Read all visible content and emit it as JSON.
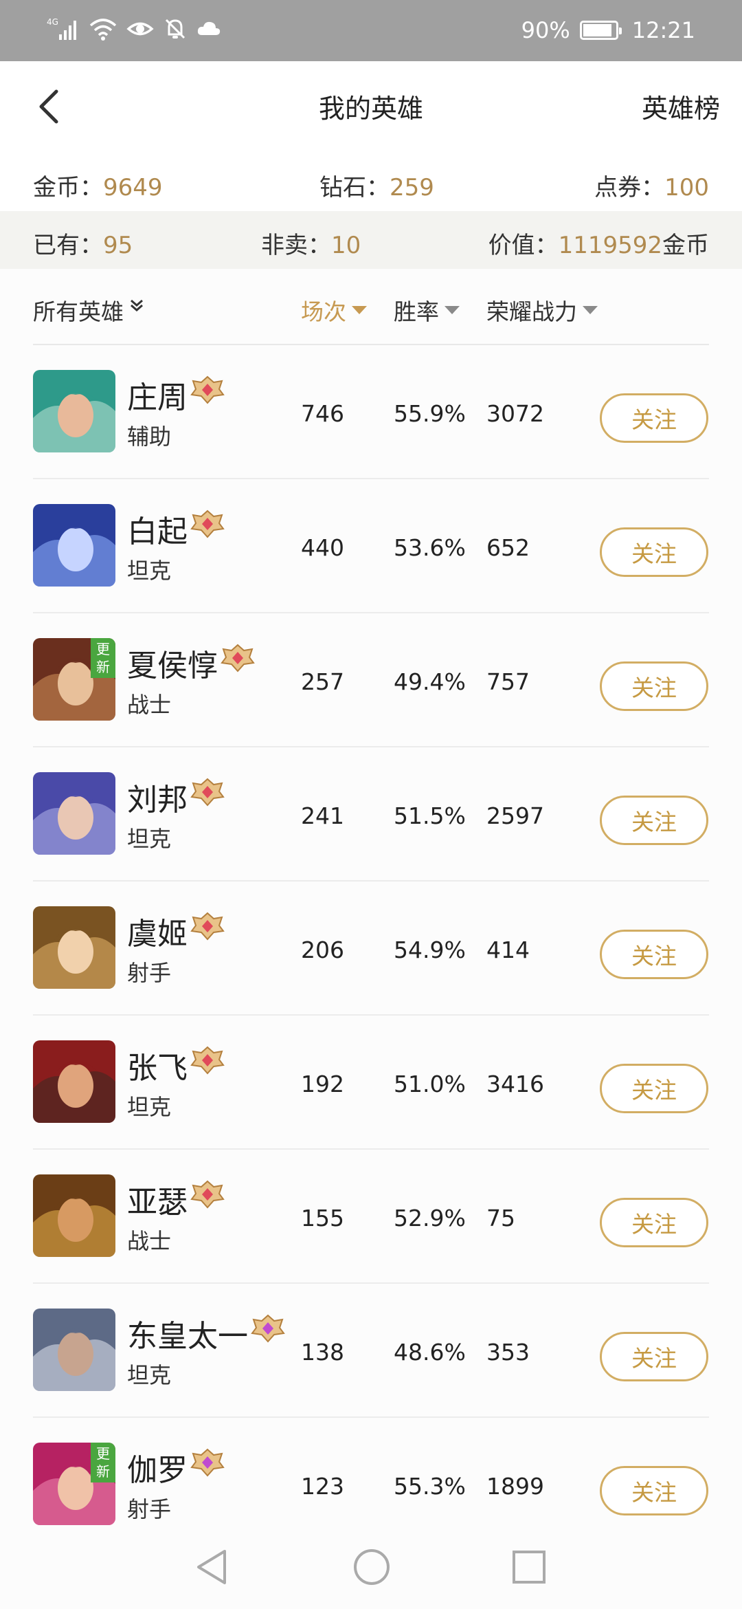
{
  "status_bar": {
    "network": "4G",
    "battery_text": "90%",
    "battery_level": 0.9,
    "time": "12:21"
  },
  "nav": {
    "title": "我的英雄",
    "right_link": "英雄榜"
  },
  "currency": {
    "gold_label": "金币：",
    "gold_value": "9649",
    "diamond_label": "钻石：",
    "diamond_value": "259",
    "voucher_label": "点券：",
    "voucher_value": "100"
  },
  "summary": {
    "owned_label": "已有：",
    "owned_value": "95",
    "not_for_sale_label": "非卖：",
    "not_for_sale_value": "10",
    "worth_label": "价值：",
    "worth_value": "1119592",
    "worth_unit": "金币"
  },
  "table_header": {
    "filter_label": "所有英雄",
    "matches": "场次",
    "winrate": "胜率",
    "power": "荣耀战力"
  },
  "follow_label": "关注",
  "heroes": [
    {
      "name": "庄周",
      "role": "辅助",
      "matches": "746",
      "winrate": "55.9%",
      "power": "3072",
      "new": false,
      "badge": "",
      "gem": "#e04a5a"
    },
    {
      "name": "白起",
      "role": "坦克",
      "matches": "440",
      "winrate": "53.6%",
      "power": "652",
      "new": false,
      "badge": "",
      "gem": "#e04a5a"
    },
    {
      "name": "夏侯惇",
      "role": "战士",
      "matches": "257",
      "winrate": "49.4%",
      "power": "757",
      "new": true,
      "badge": "更新",
      "gem": "#e04a5a"
    },
    {
      "name": "刘邦",
      "role": "坦克",
      "matches": "241",
      "winrate": "51.5%",
      "power": "2597",
      "new": false,
      "badge": "",
      "gem": "#e04a5a"
    },
    {
      "name": "虞姬",
      "role": "射手",
      "matches": "206",
      "winrate": "54.9%",
      "power": "414",
      "new": false,
      "badge": "",
      "gem": "#e04a5a"
    },
    {
      "name": "张飞",
      "role": "坦克",
      "matches": "192",
      "winrate": "51.0%",
      "power": "3416",
      "new": false,
      "badge": "",
      "gem": "#e04a5a"
    },
    {
      "name": "亚瑟",
      "role": "战士",
      "matches": "155",
      "winrate": "52.9%",
      "power": "75",
      "new": false,
      "badge": "",
      "gem": "#e04a5a"
    },
    {
      "name": "东皇太一",
      "role": "坦克",
      "matches": "138",
      "winrate": "48.6%",
      "power": "353",
      "new": false,
      "badge": "",
      "gem": "#c04ad0"
    },
    {
      "name": "伽罗",
      "role": "射手",
      "matches": "123",
      "winrate": "55.3%",
      "power": "1899",
      "new": true,
      "badge": "更新",
      "gem": "#c04ad0"
    }
  ],
  "colors": {
    "accent_gold": "#c79a52",
    "status_bar_bg": "#a0a0a0",
    "new_badge_bg": "#4aa63f"
  }
}
